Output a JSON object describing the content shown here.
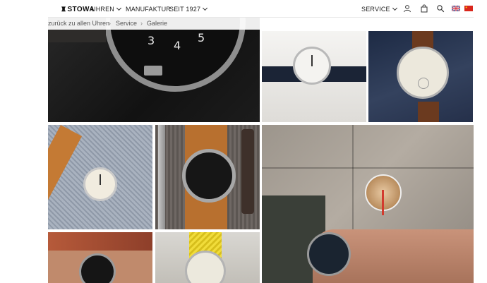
{
  "header": {
    "brand": "STOWA",
    "nav": [
      {
        "label": "UHREN",
        "has_dropdown": true
      },
      {
        "label": "MANUFAKTUR",
        "has_dropdown": false
      },
      {
        "label": "SEIT 1927",
        "has_dropdown": true
      }
    ],
    "service_label": "SERVICE",
    "icons": [
      "user-icon",
      "bag-icon",
      "search-icon",
      "flag-uk-icon",
      "flag-china-icon"
    ]
  },
  "breadcrumb": {
    "back_label": "zurück zu allen Uhren",
    "items": [
      "Service",
      "Galerie"
    ]
  },
  "gallery": {
    "tile_count": 8
  },
  "colors": {
    "header_bg": "#ffffff",
    "text": "#222222",
    "dial_dark": "#111111",
    "dial_light": "#efece4",
    "strap_tan": "#b8702f"
  }
}
